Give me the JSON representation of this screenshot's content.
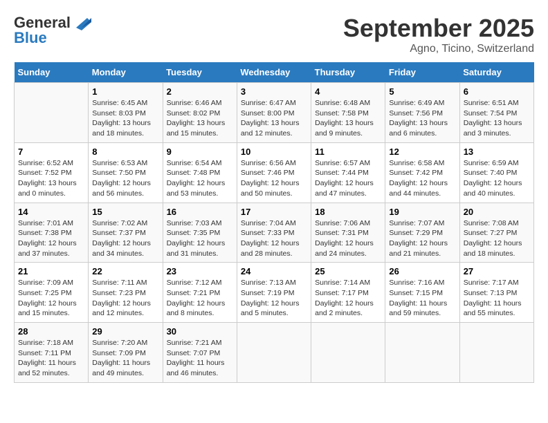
{
  "logo": {
    "line1": "General",
    "line2": "Blue"
  },
  "title": "September 2025",
  "subtitle": "Agno, Ticino, Switzerland",
  "days_of_week": [
    "Sunday",
    "Monday",
    "Tuesday",
    "Wednesday",
    "Thursday",
    "Friday",
    "Saturday"
  ],
  "weeks": [
    [
      {
        "num": "",
        "sunrise": "",
        "sunset": "",
        "daylight": ""
      },
      {
        "num": "1",
        "sunrise": "Sunrise: 6:45 AM",
        "sunset": "Sunset: 8:03 PM",
        "daylight": "Daylight: 13 hours and 18 minutes."
      },
      {
        "num": "2",
        "sunrise": "Sunrise: 6:46 AM",
        "sunset": "Sunset: 8:02 PM",
        "daylight": "Daylight: 13 hours and 15 minutes."
      },
      {
        "num": "3",
        "sunrise": "Sunrise: 6:47 AM",
        "sunset": "Sunset: 8:00 PM",
        "daylight": "Daylight: 13 hours and 12 minutes."
      },
      {
        "num": "4",
        "sunrise": "Sunrise: 6:48 AM",
        "sunset": "Sunset: 7:58 PM",
        "daylight": "Daylight: 13 hours and 9 minutes."
      },
      {
        "num": "5",
        "sunrise": "Sunrise: 6:49 AM",
        "sunset": "Sunset: 7:56 PM",
        "daylight": "Daylight: 13 hours and 6 minutes."
      },
      {
        "num": "6",
        "sunrise": "Sunrise: 6:51 AM",
        "sunset": "Sunset: 7:54 PM",
        "daylight": "Daylight: 13 hours and 3 minutes."
      }
    ],
    [
      {
        "num": "7",
        "sunrise": "Sunrise: 6:52 AM",
        "sunset": "Sunset: 7:52 PM",
        "daylight": "Daylight: 13 hours and 0 minutes."
      },
      {
        "num": "8",
        "sunrise": "Sunrise: 6:53 AM",
        "sunset": "Sunset: 7:50 PM",
        "daylight": "Daylight: 12 hours and 56 minutes."
      },
      {
        "num": "9",
        "sunrise": "Sunrise: 6:54 AM",
        "sunset": "Sunset: 7:48 PM",
        "daylight": "Daylight: 12 hours and 53 minutes."
      },
      {
        "num": "10",
        "sunrise": "Sunrise: 6:56 AM",
        "sunset": "Sunset: 7:46 PM",
        "daylight": "Daylight: 12 hours and 50 minutes."
      },
      {
        "num": "11",
        "sunrise": "Sunrise: 6:57 AM",
        "sunset": "Sunset: 7:44 PM",
        "daylight": "Daylight: 12 hours and 47 minutes."
      },
      {
        "num": "12",
        "sunrise": "Sunrise: 6:58 AM",
        "sunset": "Sunset: 7:42 PM",
        "daylight": "Daylight: 12 hours and 44 minutes."
      },
      {
        "num": "13",
        "sunrise": "Sunrise: 6:59 AM",
        "sunset": "Sunset: 7:40 PM",
        "daylight": "Daylight: 12 hours and 40 minutes."
      }
    ],
    [
      {
        "num": "14",
        "sunrise": "Sunrise: 7:01 AM",
        "sunset": "Sunset: 7:38 PM",
        "daylight": "Daylight: 12 hours and 37 minutes."
      },
      {
        "num": "15",
        "sunrise": "Sunrise: 7:02 AM",
        "sunset": "Sunset: 7:37 PM",
        "daylight": "Daylight: 12 hours and 34 minutes."
      },
      {
        "num": "16",
        "sunrise": "Sunrise: 7:03 AM",
        "sunset": "Sunset: 7:35 PM",
        "daylight": "Daylight: 12 hours and 31 minutes."
      },
      {
        "num": "17",
        "sunrise": "Sunrise: 7:04 AM",
        "sunset": "Sunset: 7:33 PM",
        "daylight": "Daylight: 12 hours and 28 minutes."
      },
      {
        "num": "18",
        "sunrise": "Sunrise: 7:06 AM",
        "sunset": "Sunset: 7:31 PM",
        "daylight": "Daylight: 12 hours and 24 minutes."
      },
      {
        "num": "19",
        "sunrise": "Sunrise: 7:07 AM",
        "sunset": "Sunset: 7:29 PM",
        "daylight": "Daylight: 12 hours and 21 minutes."
      },
      {
        "num": "20",
        "sunrise": "Sunrise: 7:08 AM",
        "sunset": "Sunset: 7:27 PM",
        "daylight": "Daylight: 12 hours and 18 minutes."
      }
    ],
    [
      {
        "num": "21",
        "sunrise": "Sunrise: 7:09 AM",
        "sunset": "Sunset: 7:25 PM",
        "daylight": "Daylight: 12 hours and 15 minutes."
      },
      {
        "num": "22",
        "sunrise": "Sunrise: 7:11 AM",
        "sunset": "Sunset: 7:23 PM",
        "daylight": "Daylight: 12 hours and 12 minutes."
      },
      {
        "num": "23",
        "sunrise": "Sunrise: 7:12 AM",
        "sunset": "Sunset: 7:21 PM",
        "daylight": "Daylight: 12 hours and 8 minutes."
      },
      {
        "num": "24",
        "sunrise": "Sunrise: 7:13 AM",
        "sunset": "Sunset: 7:19 PM",
        "daylight": "Daylight: 12 hours and 5 minutes."
      },
      {
        "num": "25",
        "sunrise": "Sunrise: 7:14 AM",
        "sunset": "Sunset: 7:17 PM",
        "daylight": "Daylight: 12 hours and 2 minutes."
      },
      {
        "num": "26",
        "sunrise": "Sunrise: 7:16 AM",
        "sunset": "Sunset: 7:15 PM",
        "daylight": "Daylight: 11 hours and 59 minutes."
      },
      {
        "num": "27",
        "sunrise": "Sunrise: 7:17 AM",
        "sunset": "Sunset: 7:13 PM",
        "daylight": "Daylight: 11 hours and 55 minutes."
      }
    ],
    [
      {
        "num": "28",
        "sunrise": "Sunrise: 7:18 AM",
        "sunset": "Sunset: 7:11 PM",
        "daylight": "Daylight: 11 hours and 52 minutes."
      },
      {
        "num": "29",
        "sunrise": "Sunrise: 7:20 AM",
        "sunset": "Sunset: 7:09 PM",
        "daylight": "Daylight: 11 hours and 49 minutes."
      },
      {
        "num": "30",
        "sunrise": "Sunrise: 7:21 AM",
        "sunset": "Sunset: 7:07 PM",
        "daylight": "Daylight: 11 hours and 46 minutes."
      },
      {
        "num": "",
        "sunrise": "",
        "sunset": "",
        "daylight": ""
      },
      {
        "num": "",
        "sunrise": "",
        "sunset": "",
        "daylight": ""
      },
      {
        "num": "",
        "sunrise": "",
        "sunset": "",
        "daylight": ""
      },
      {
        "num": "",
        "sunrise": "",
        "sunset": "",
        "daylight": ""
      }
    ]
  ]
}
